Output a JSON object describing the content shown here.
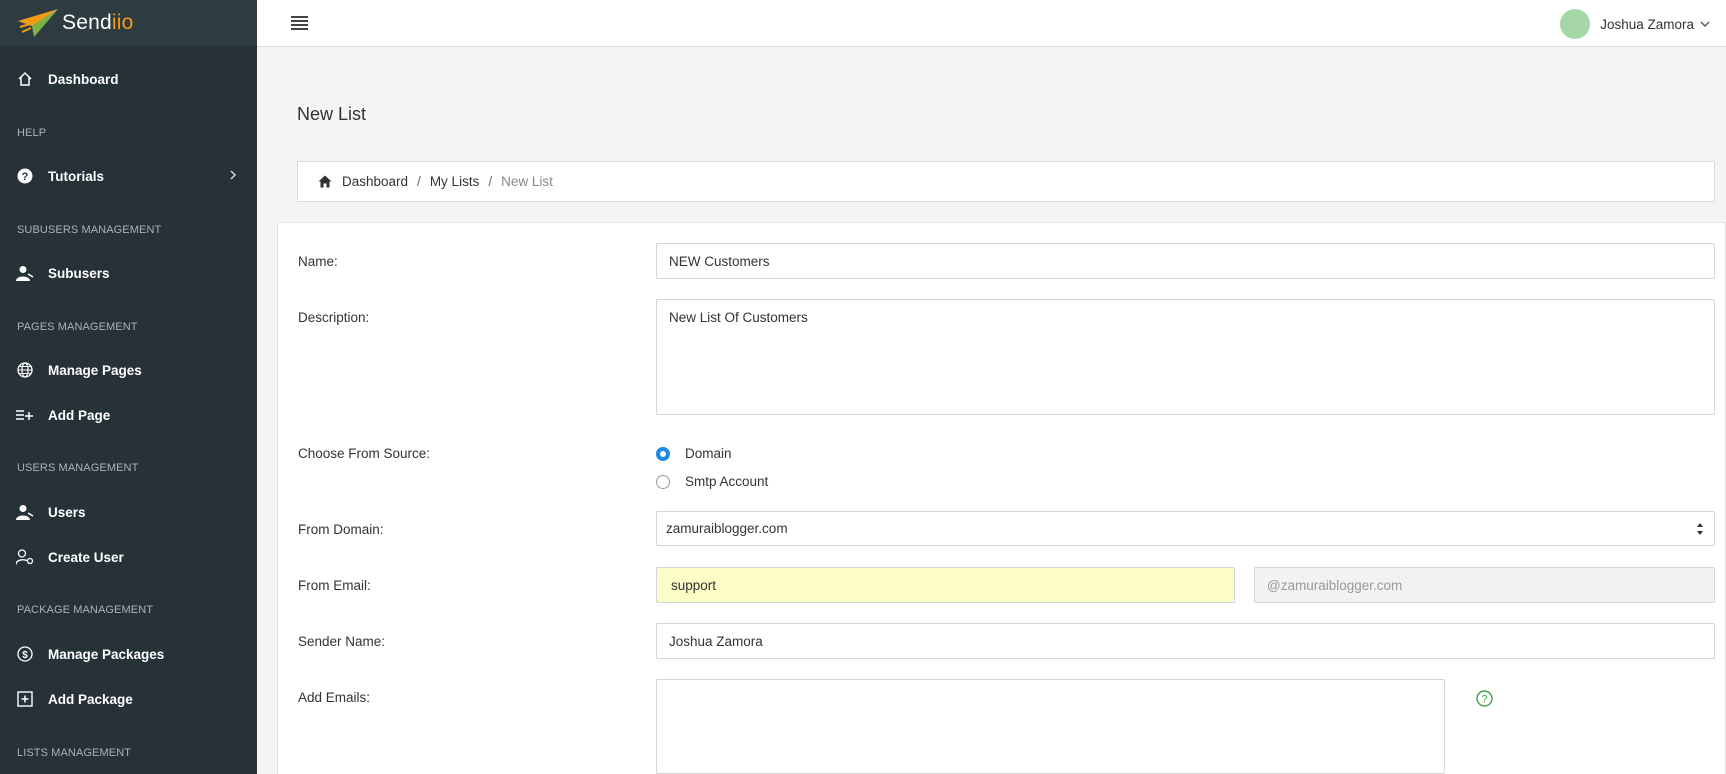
{
  "brand": {
    "name_main": "Send",
    "name_accent": "iio"
  },
  "sidebar": {
    "items": [
      {
        "label": "Dashboard",
        "icon": "home-icon"
      },
      {
        "section": "HELP"
      },
      {
        "label": "Tutorials",
        "icon": "question-circle-icon"
      },
      {
        "section": "SUBUSERS MANAGEMENT"
      },
      {
        "label": "Subusers",
        "icon": "user-icon"
      },
      {
        "section": "PAGES MANAGEMENT"
      },
      {
        "label": "Manage Pages",
        "icon": "globe-icon"
      },
      {
        "label": "Add Page",
        "icon": "list-add-icon"
      },
      {
        "section": "USERS MANAGEMENT"
      },
      {
        "label": "Users",
        "icon": "user-icon"
      },
      {
        "label": "Create User",
        "icon": "user-gear-icon"
      },
      {
        "section": "PACKAGE MANAGEMENT"
      },
      {
        "label": "Manage Packages",
        "icon": "dollar-circle-icon"
      },
      {
        "label": "Add Package",
        "icon": "plus-square-icon"
      },
      {
        "section": "LISTS MANAGEMENT"
      }
    ]
  },
  "header": {
    "user_name": "Joshua Zamora",
    "avatar_color": "#a5d6a7"
  },
  "page": {
    "title": "New List"
  },
  "breadcrumb": {
    "items": [
      "Dashboard",
      "My Lists"
    ],
    "current": "New List"
  },
  "form": {
    "name": {
      "label": "Name:",
      "value": "NEW Customers"
    },
    "description": {
      "label": "Description:",
      "value": "New List Of Customers"
    },
    "source": {
      "label": "Choose From Source:",
      "options": [
        "Domain",
        "Smtp Account"
      ],
      "selected": "Domain"
    },
    "from_domain": {
      "label": "From Domain:",
      "value": "zamuraiblogger.com"
    },
    "from_email": {
      "label": "From Email:",
      "value": "support",
      "domain_placeholder": "@zamuraiblogger.com"
    },
    "sender_name": {
      "label": "Sender Name:",
      "value": "Joshua Zamora"
    },
    "add_emails": {
      "label": "Add Emails:",
      "value": ""
    }
  },
  "colors": {
    "sidebar": "#263238",
    "accent": "#1e88e5",
    "help": "#43a047",
    "brand_accent": "#f39c12"
  }
}
